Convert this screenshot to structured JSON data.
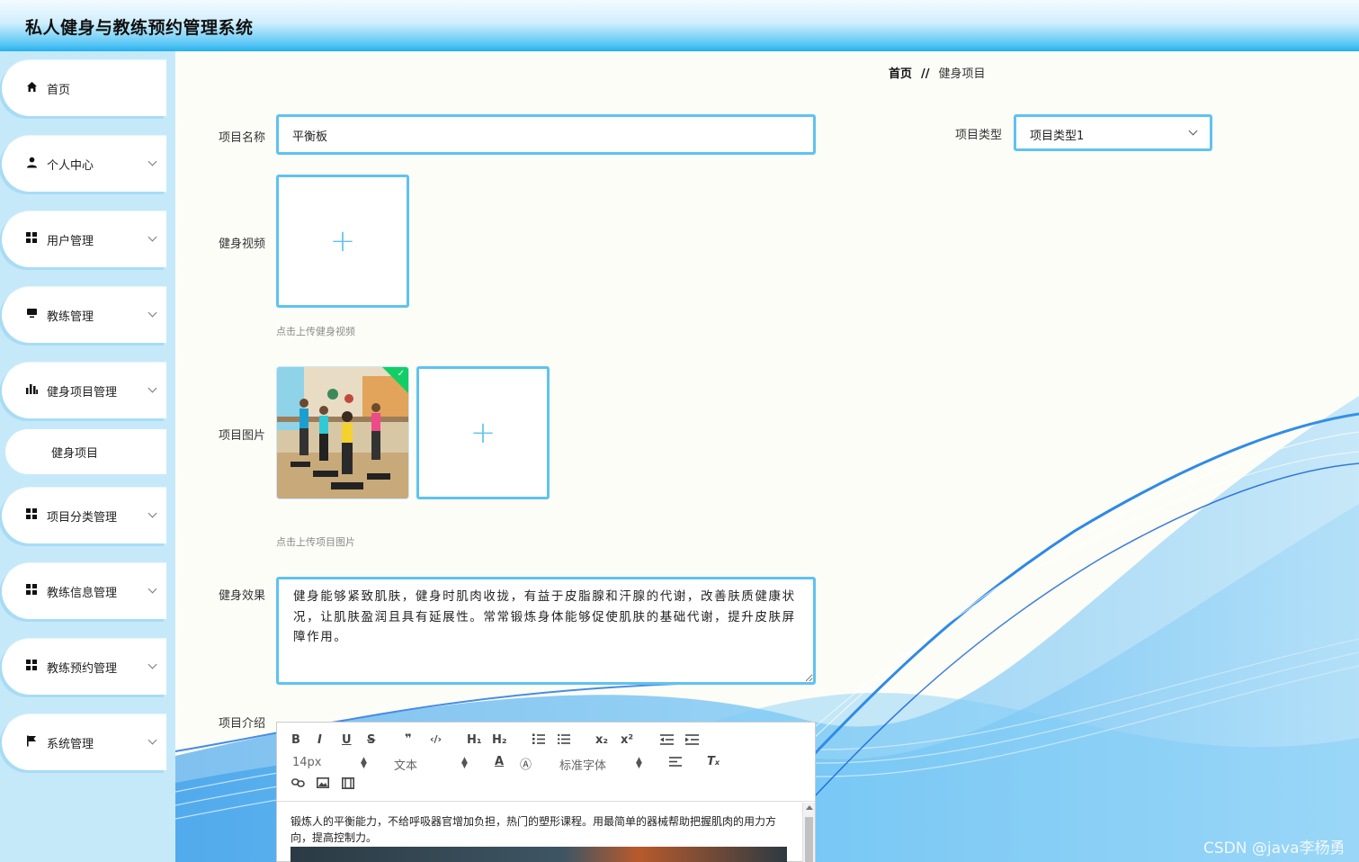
{
  "app": {
    "title": "私人健身与教练预约管理系统"
  },
  "sidebar": {
    "items": [
      {
        "label": "首页",
        "icon": "home-icon"
      },
      {
        "label": "个人中心",
        "icon": "user-icon"
      },
      {
        "label": "用户管理",
        "icon": "grid-icon"
      },
      {
        "label": "教练管理",
        "icon": "monitor-icon"
      },
      {
        "label": "健身项目管理",
        "icon": "bar-chart-icon"
      },
      {
        "label": "健身项目",
        "icon": ""
      },
      {
        "label": "项目分类管理",
        "icon": "grid-icon"
      },
      {
        "label": "教练信息管理",
        "icon": "grid-icon"
      },
      {
        "label": "教练预约管理",
        "icon": "grid-icon"
      },
      {
        "label": "系统管理",
        "icon": "flag-icon"
      }
    ]
  },
  "breadcrumb": {
    "home": "首页",
    "separator": "//",
    "current": "健身项目"
  },
  "form": {
    "name_label": "项目名称",
    "name_value": "平衡板",
    "type_label": "项目类型",
    "type_value": "项目类型1",
    "video_label": "健身视频",
    "video_hint": "点击上传健身视频",
    "image_label": "项目图片",
    "image_hint": "点击上传项目图片",
    "effect_label": "健身效果",
    "effect_value": "健身能够紧致肌肤，健身时肌肉收拢，有益于皮脂腺和汗腺的代谢，改善肤质健康状况，让肌肤盈润且具有延展性。常常锻炼身体能够促使肌肤的基础代谢，提升皮肤屏障作用。",
    "intro_label": "项目介绍"
  },
  "editor": {
    "toolbar": {
      "bold": "B",
      "italic": "I",
      "underline": "U",
      "strike": "S",
      "quote": "❞",
      "code": "‹/›",
      "h1": "H₁",
      "h2": "H₂",
      "sub": "x₂",
      "sup": "x²",
      "font_size": "14px",
      "block_type": "文本",
      "font_family": "标准字体"
    },
    "content": "锻炼人的平衡能力，不给呼吸器官增加负担，热门的塑形课程。用最简单的器械帮助把握肌肉的用力方向，提高控制力。"
  },
  "watermark": "CSDN @java李杨勇",
  "colors": {
    "accent": "#5ec3ef",
    "sidebar_bg": "#c6e9fa",
    "success": "#13ce66"
  }
}
